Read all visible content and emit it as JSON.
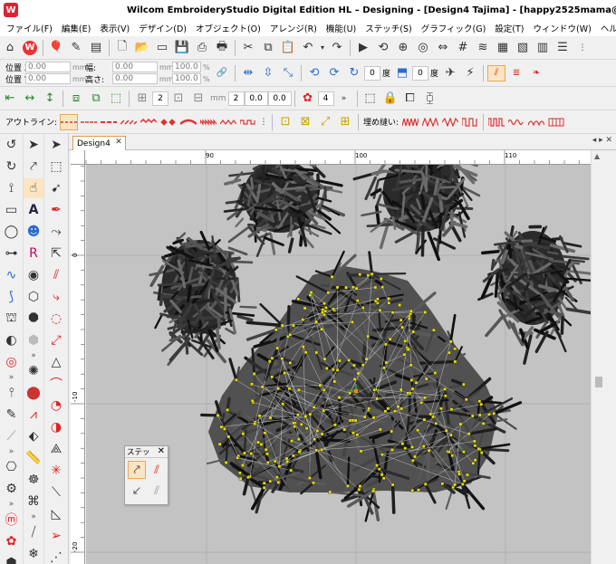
{
  "window": {
    "title": "Wilcom EmbroideryStudio Digital Edition HL – Designing - [Design4        Tajima] - [happy2525mama@yahoo"
  },
  "menu": [
    "ファイル(F)",
    "編集(E)",
    "表示(V)",
    "デザイン(D)",
    "オブジェクト(O)",
    "アレンジ(R)",
    "機能(U)",
    "ステッチ(S)",
    "グラフィック(G)",
    "設定(T)",
    "ウィンドウ(W)",
    "ヘルプ(H)"
  ],
  "properties": {
    "pos_x_label": "位置 X:",
    "pos_y_label": "位置 Y:",
    "pos_x": "0.00",
    "pos_y": "0.00",
    "unit_mm": "mm",
    "width_label": "幅:",
    "height_label": "高さ:",
    "width": "0.00",
    "height": "0.00",
    "scale_w": "100.00",
    "scale_h": "100.00",
    "unit_pct": "%",
    "rotate_value": "0",
    "rotate_unit": "度",
    "slant_value": "0",
    "slant_unit": "度"
  },
  "arrange": {
    "spacing_1": "2",
    "spacing_2": "2",
    "offset_1": "0.0",
    "offset_2": "0.0",
    "count": "4",
    "unit_mm": "mm"
  },
  "outline": {
    "label": "アウトライン:",
    "fill_label": "埋め縫い:"
  },
  "doc_tab": {
    "label": "Design4",
    "close": "✕"
  },
  "ruler": {
    "h_labels": [
      "90",
      "100",
      "110"
    ],
    "v_labels": [
      "0",
      "-10",
      "-20"
    ]
  },
  "stitch_panel": {
    "title": "ステッ",
    "close": "✕"
  },
  "colors": {
    "accent": "#e5a860",
    "canvas": "#c3c3c3",
    "node": "#e8e000"
  }
}
